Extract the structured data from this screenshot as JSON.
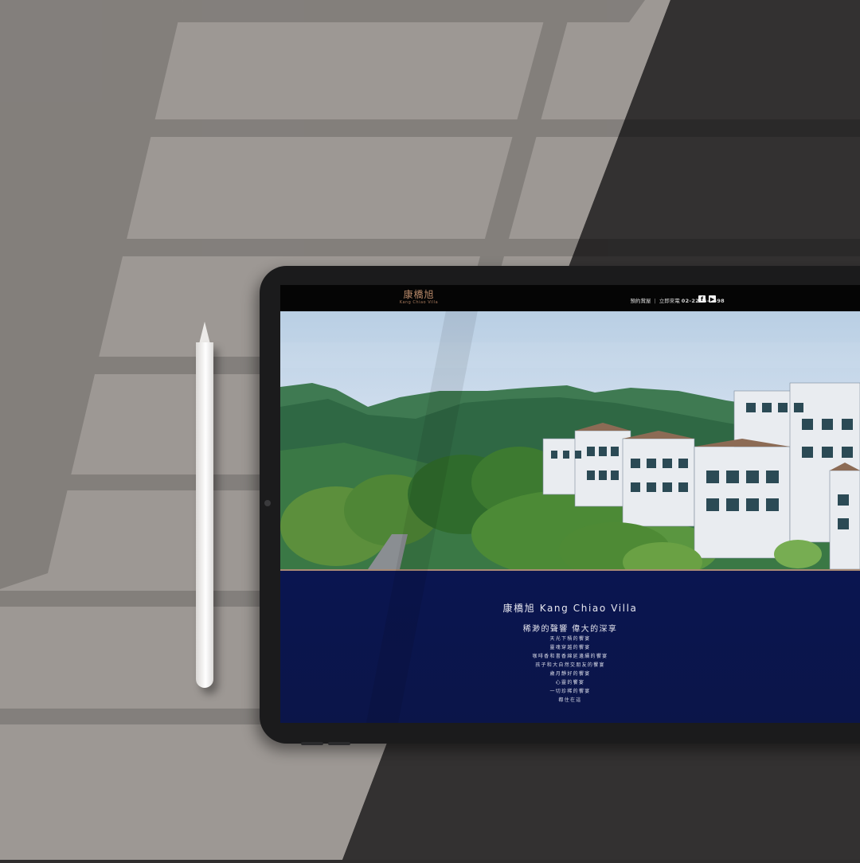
{
  "site": {
    "logo_cn": "康橋旭",
    "logo_en": "Kang Chiao Villa",
    "nav": {
      "booking": "預約賞屋",
      "call_label": "立即來電",
      "phone": "02-2216-1698"
    },
    "social_icons": [
      "facebook-icon",
      "youtube-icon"
    ]
  },
  "hero": {
    "image": "aerial view of villas among forested mountains"
  },
  "info": {
    "title": "康橋旭 Kang Chiao Villa",
    "subtitle": "稀渺的聲響 偉大的深享",
    "poem": [
      "天光下積的饗宴",
      "靈魂穿越的饗宴",
      "咖啡香和書香綿延邊續的饗宴",
      "孩子和大自然交朋友的饗宴",
      "歲月靜好的饗宴",
      "心靈的饗宴",
      "一切珍稀的饗宴",
      "都住在這"
    ]
  },
  "colors": {
    "brand_copper": "#b98a6a",
    "info_navy": "#0a1550",
    "desk_light": "#9d9894",
    "desk_dark": "#333131"
  }
}
